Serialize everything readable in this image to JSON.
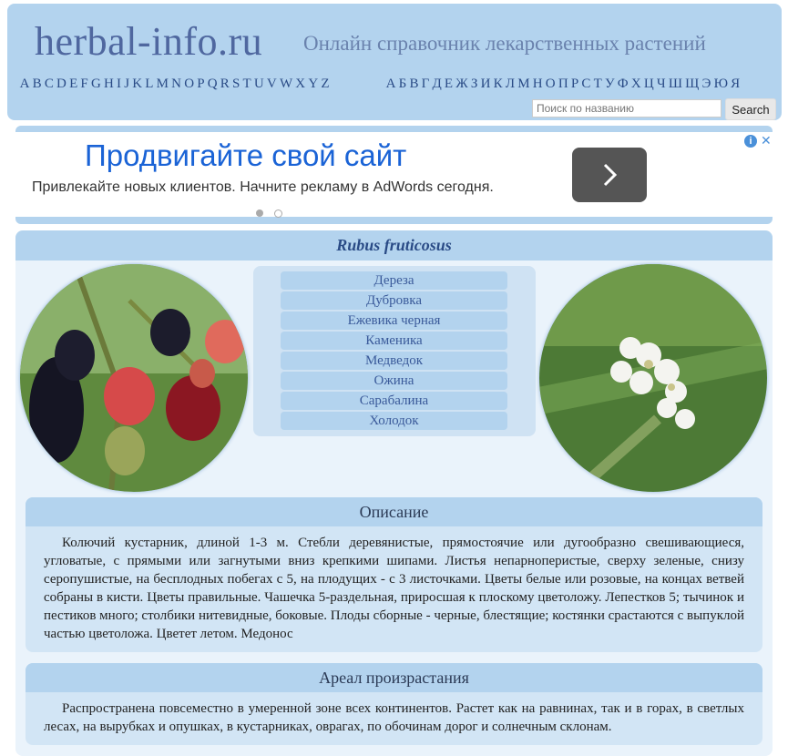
{
  "header": {
    "site_title": "herbal-info.ru",
    "subtitle": "Онлайн справочник лекарственных растений",
    "latin_letters": [
      "A",
      "B",
      "C",
      "D",
      "E",
      "F",
      "G",
      "H",
      "I",
      "J",
      "K",
      "L",
      "M",
      "N",
      "O",
      "P",
      "Q",
      "R",
      "S",
      "T",
      "U",
      "V",
      "W",
      "X",
      "Y",
      "Z"
    ],
    "cyrillic_letters": [
      "А",
      "Б",
      "В",
      "Г",
      "Д",
      "Е",
      "Ж",
      "З",
      "И",
      "К",
      "Л",
      "М",
      "Н",
      "О",
      "П",
      "Р",
      "С",
      "Т",
      "У",
      "Ф",
      "Х",
      "Ц",
      "Ч",
      "Ш",
      "Щ",
      "Э",
      "Ю",
      "Я"
    ],
    "search": {
      "placeholder": "Поиск по названию",
      "button_label": "Search"
    }
  },
  "ad": {
    "headline": "Продвигайте свой сайт",
    "text": "Привлекайте новых клиентов. Начните рекламу в AdWords сегодня.",
    "info_icon": "info-icon",
    "close_icon": "close-icon",
    "arrow_icon": "chevron-right-icon"
  },
  "plant": {
    "latin_name": "Rubus fruticosus",
    "common_names": [
      "Дереза",
      "Дубровка",
      "Ежевика черная",
      "Каменика",
      "Медведок",
      "Ожина",
      "Сарабалина",
      "Холодок"
    ],
    "description_title": "Описание",
    "description": "Колючий кустарник, длиной 1-3 м. Стебли деревянистые, прямостоячие или дугообразно свешивающиеся, угловатые, с прямыми или загнутыми вниз крепкими шипами. Листья непарноперистые, сверху зеленые, снизу серопушистые, на бесплодных побегах с 5, на плодущих - с 3 листочками. Цветы белые или розовые, на концах ветвей собраны в кисти. Цветы правильные. Чашечка 5-раздельная, приросшая к плоскому цветоложу. Лепестков 5; тычинок и пестиков много; столбики нитевидные, боковые. Плоды сборные - черные, блестящие; костянки срастаются с выпуклой частью цветоложа. Цветет летом. Медонос",
    "range_title": "Ареал произрастания",
    "range": "Распространена повсеместно в умеренной зоне всех континентов. Растет как на равнинах, так и в горах, в светлых лесах, на вырубках и опушках, в кустарниках, оврагах, по обочинам дорог и солнечным склонам."
  },
  "colors": {
    "header_bg": "#b3d3ee",
    "title_color": "#4f679f",
    "link_color": "#2a4b86",
    "ad_headline": "#1a63d6",
    "panel_bg": "#eaf3fb"
  }
}
